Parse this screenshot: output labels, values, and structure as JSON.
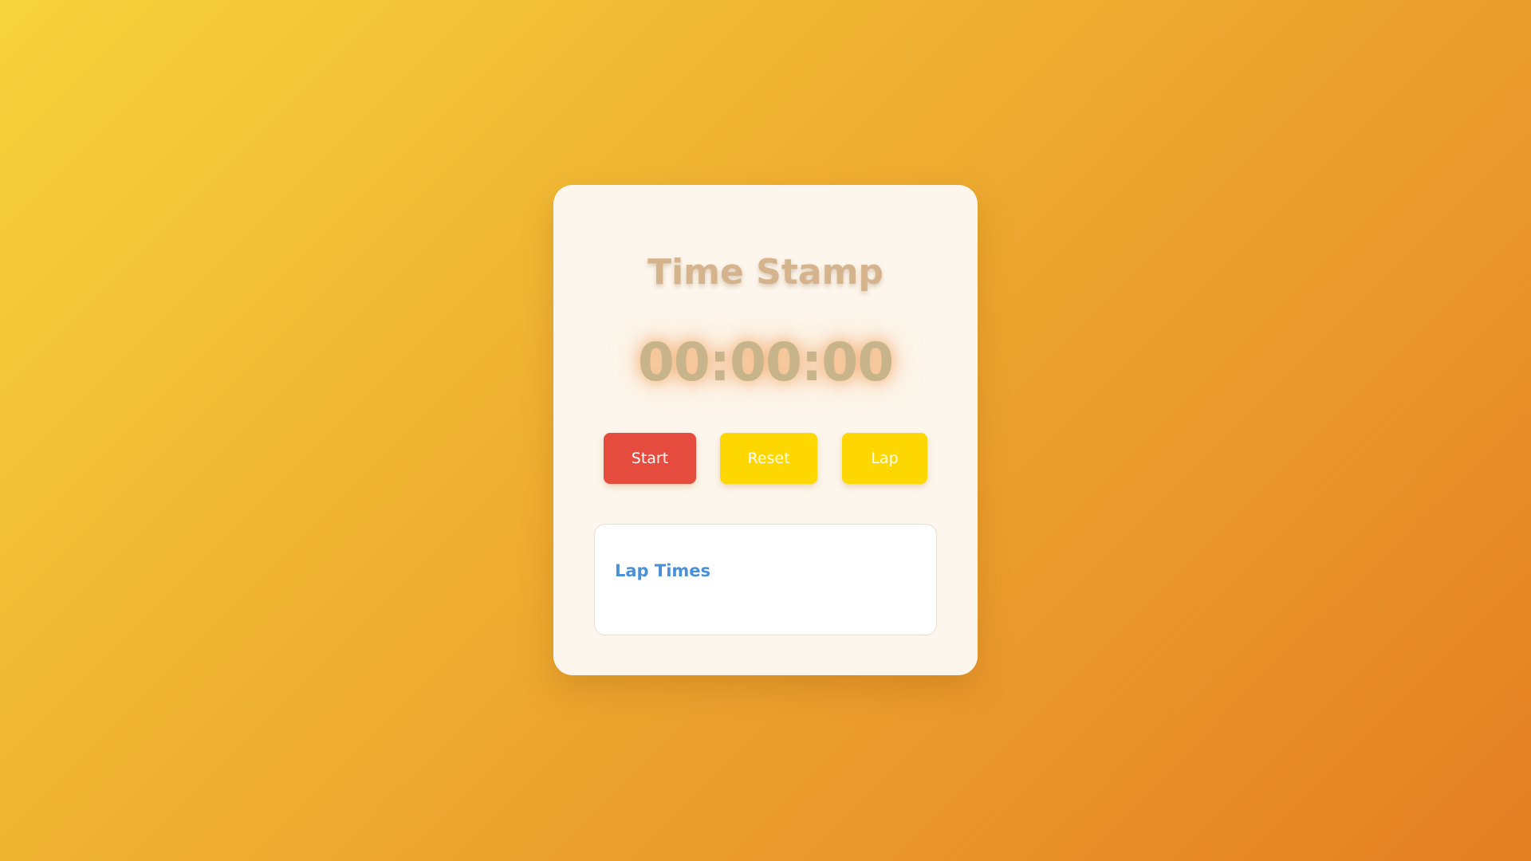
{
  "app": {
    "title": "Time Stamp"
  },
  "timer": {
    "display": "00:00:00"
  },
  "controls": {
    "start_label": "Start",
    "reset_label": "Reset",
    "lap_label": "Lap"
  },
  "laps": {
    "heading": "Lap Times",
    "items": []
  },
  "colors": {
    "start_button": "#e64c3d",
    "reset_button": "#fed700",
    "lap_button": "#fed700",
    "laps_heading": "#4a90d9",
    "title": "#d5b48d",
    "timer": "#c7b48a"
  }
}
